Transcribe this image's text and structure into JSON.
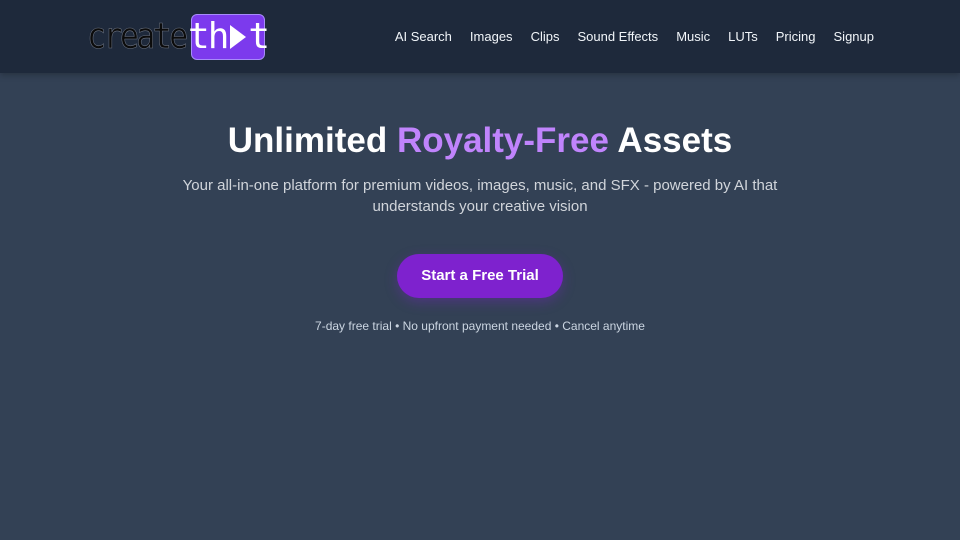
{
  "brand": {
    "logo_left": "create",
    "logo_right_start": "th",
    "logo_right_end": "t",
    "accent": "#7c3aed"
  },
  "nav": {
    "items": [
      {
        "label": "AI Search"
      },
      {
        "label": "Images"
      },
      {
        "label": "Clips"
      },
      {
        "label": "Sound Effects"
      },
      {
        "label": "Music"
      },
      {
        "label": "LUTs"
      },
      {
        "label": "Pricing"
      },
      {
        "label": "Signup"
      }
    ]
  },
  "hero": {
    "title_prefix": "Unlimited ",
    "title_accent": "Royalty-Free",
    "title_suffix": " Assets",
    "subtitle": "Your all-in-one platform for premium videos, images, music, and SFX - powered by AI that understands your creative vision",
    "cta_label": "Start a Free Trial",
    "fineprint": "7-day free trial • No upfront payment needed • Cancel anytime"
  },
  "colors": {
    "page_bg": "#334155",
    "nav_bg": "#1e293b",
    "title_accent": "#c084fc",
    "cta_bg": "#7e22ce"
  }
}
